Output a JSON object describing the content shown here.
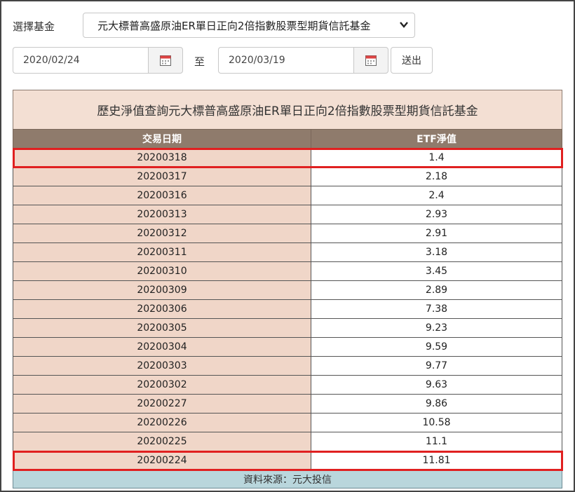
{
  "form": {
    "fund_label": "選擇基金",
    "fund_selected": "元大標普高盛原油ER單日正向2倍指數股票型期貨信託基金",
    "start_date": "2020/02/24",
    "to_label": "至",
    "end_date": "2020/03/19",
    "submit_label": "送出"
  },
  "table": {
    "title": "歷史淨值查詢元大標普高盛原油ER單日正向2倍指數股票型期貨信託基金",
    "headers": [
      "交易日期",
      "ETF淨值"
    ],
    "rows": [
      {
        "date": "20200318",
        "nav": "1.4",
        "highlight": true
      },
      {
        "date": "20200317",
        "nav": "2.18"
      },
      {
        "date": "20200316",
        "nav": "2.4"
      },
      {
        "date": "20200313",
        "nav": "2.93"
      },
      {
        "date": "20200312",
        "nav": "2.91"
      },
      {
        "date": "20200311",
        "nav": "3.18"
      },
      {
        "date": "20200310",
        "nav": "3.45"
      },
      {
        "date": "20200309",
        "nav": "2.89"
      },
      {
        "date": "20200306",
        "nav": "7.38"
      },
      {
        "date": "20200305",
        "nav": "9.23"
      },
      {
        "date": "20200304",
        "nav": "9.59"
      },
      {
        "date": "20200303",
        "nav": "9.77"
      },
      {
        "date": "20200302",
        "nav": "9.63"
      },
      {
        "date": "20200227",
        "nav": "9.86"
      },
      {
        "date": "20200226",
        "nav": "10.58"
      },
      {
        "date": "20200225",
        "nav": "11.1"
      },
      {
        "date": "20200224",
        "nav": "11.81",
        "highlight": true
      }
    ],
    "footer": "資料來源：元大投信"
  },
  "colors": {
    "title_bg": "#f3dfd3",
    "header_bg": "#8f7b6c",
    "date_cell_bg": "#f0d6c8",
    "footer_bg": "#b9d6dc",
    "highlight": "#e02020"
  }
}
